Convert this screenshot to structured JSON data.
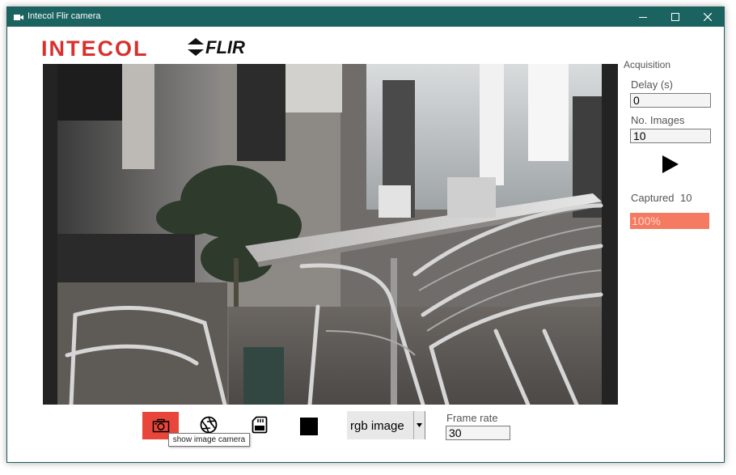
{
  "window": {
    "title": "Intecol Flir camera",
    "titlebar_color": "#1b6360"
  },
  "logo": {
    "brand_left": "INTECOL",
    "brand_right": "FLIR",
    "brand_left_color": "#d9302d"
  },
  "acquisition": {
    "heading": "Acquisition",
    "delay_label": "Delay (s)",
    "delay_value": "0",
    "images_label": "No. Images",
    "images_value": "10",
    "captured_label": "Captured",
    "captured_value": "10",
    "progress_text": "100%",
    "progress_fraction": 1.0,
    "progress_color": "#f47b62"
  },
  "toolbar": {
    "camera_button_color": "#e8463a",
    "tooltip": "show image camera",
    "mode_value": "rgb image",
    "framerate_label": "Frame rate",
    "framerate_value": "30"
  },
  "icons": {
    "app": "video-camera-icon",
    "play": "play-icon",
    "camera": "camera-icon",
    "aperture": "aperture-icon",
    "sdcard": "sd-card-icon",
    "stop": "stop-icon"
  }
}
